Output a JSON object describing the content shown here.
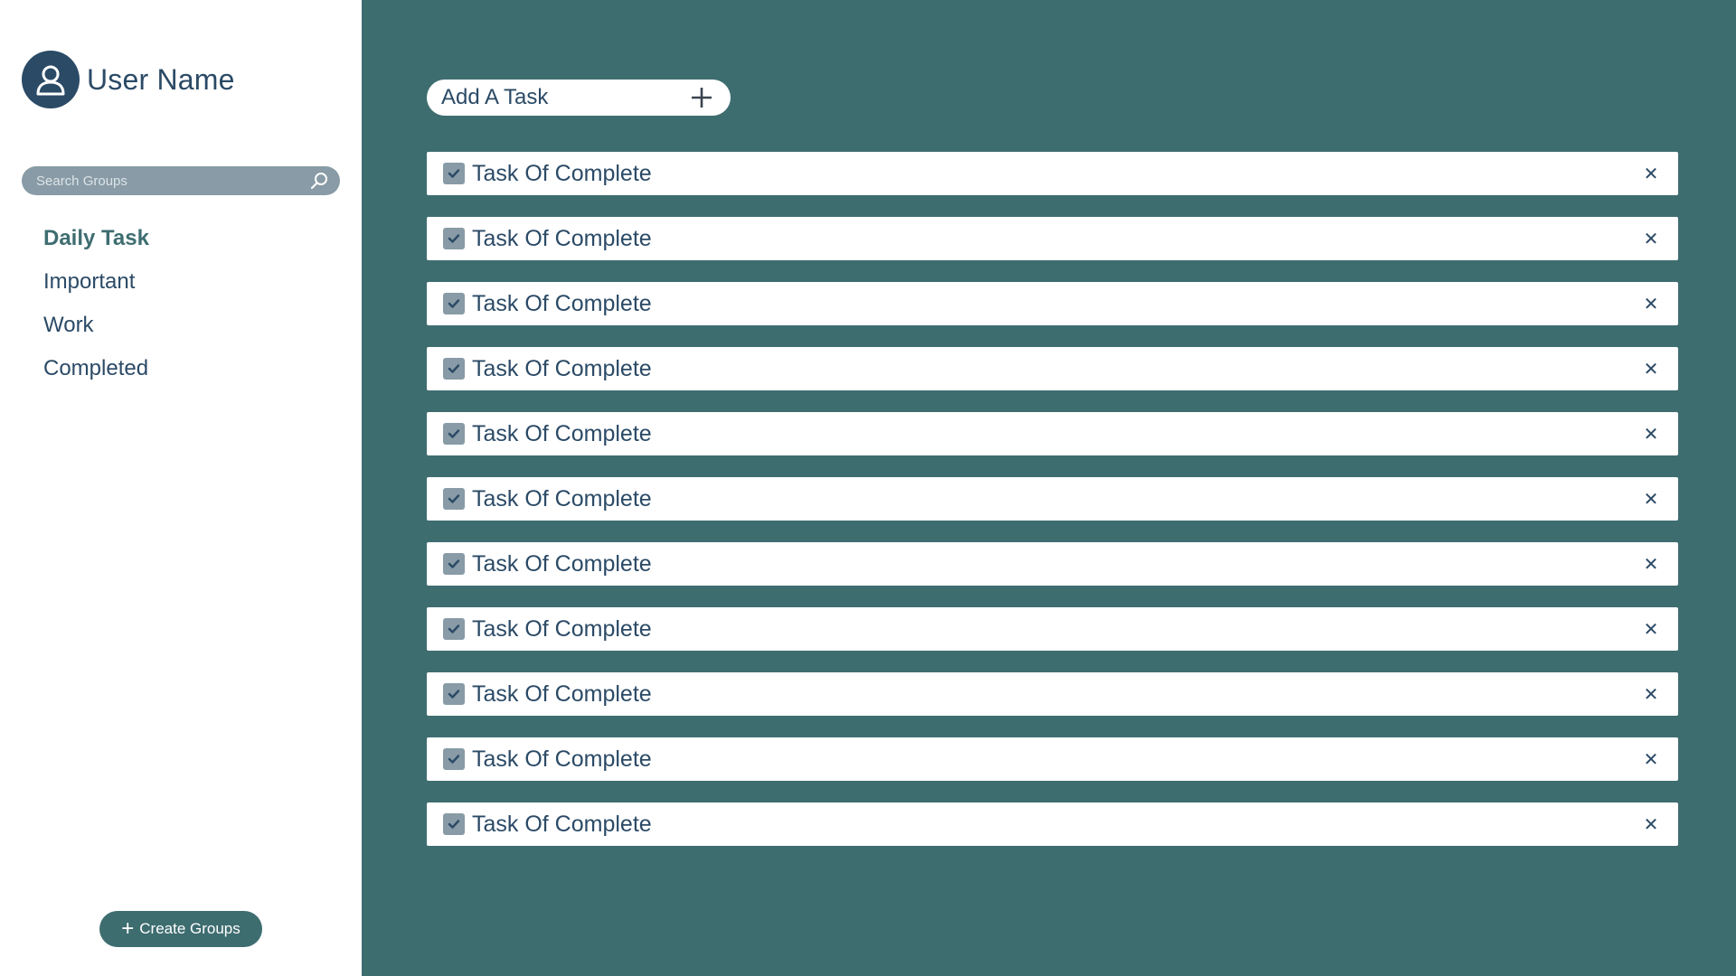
{
  "user": {
    "name": "User Name",
    "avatar_icon": "user-icon"
  },
  "search": {
    "placeholder": "Search Groups",
    "value": "",
    "icon": "search-icon"
  },
  "nav": {
    "items": [
      {
        "label": "Daily Task",
        "active": true
      },
      {
        "label": "Important",
        "active": false
      },
      {
        "label": "Work",
        "active": false
      },
      {
        "label": "Completed",
        "active": false
      }
    ]
  },
  "create_groups": {
    "label": "Create Groups",
    "icon": "plus-icon"
  },
  "add_task": {
    "label": "Add A Task",
    "icon": "plus-icon"
  },
  "tasks": [
    {
      "label": "Task Of Complete",
      "checked": true
    },
    {
      "label": "Task Of Complete",
      "checked": true
    },
    {
      "label": "Task Of Complete",
      "checked": true
    },
    {
      "label": "Task Of Complete",
      "checked": true
    },
    {
      "label": "Task Of Complete",
      "checked": true
    },
    {
      "label": "Task Of Complete",
      "checked": true
    },
    {
      "label": "Task Of Complete",
      "checked": true
    },
    {
      "label": "Task Of Complete",
      "checked": true
    },
    {
      "label": "Task Of Complete",
      "checked": true
    },
    {
      "label": "Task Of Complete",
      "checked": true
    },
    {
      "label": "Task Of Complete",
      "checked": true
    }
  ],
  "colors": {
    "background": "#3e6d70",
    "sidebar": "#ffffff",
    "primary_text": "#2b4a66",
    "accent": "#3e6d70",
    "muted": "#889ba6"
  }
}
